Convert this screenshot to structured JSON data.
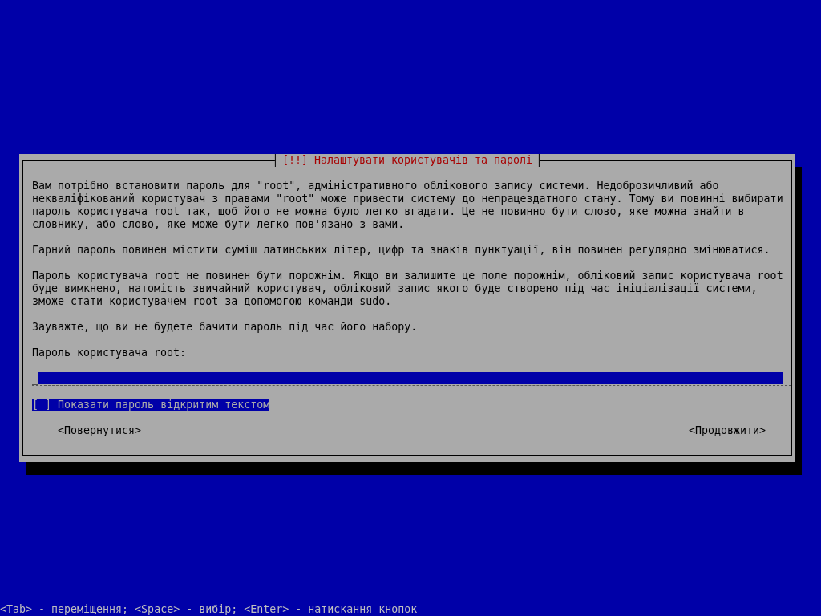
{
  "dialog": {
    "title": "[!!] Налаштувати користувачів та паролі",
    "paragraphs": [
      {
        "lines": [
          "Вам потрібно встановити пароль для \"root\", адміністративного облікового запису системи. Недоброзичливий або",
          "некваліфікований користувач з правами \"root\" може привести систему до непрацездатного стану. Тому ви повинні вибирати",
          "пароль користувача root так, щоб його не можна було легко вгадати. Це не повинно бути слово, яке можна знайти в",
          "словнику, або слово, яке може бути легко пов'язано з вами."
        ]
      },
      {
        "lines": [
          "Гарний пароль повинен містити суміш латинських літер, цифр та знаків пунктуації, він повинен регулярно змінюватися."
        ]
      },
      {
        "lines": [
          "Пароль користувача root не повинен бути порожнім. Якщо ви залишите це поле порожнім, обліковий запис користувача root",
          "буде вимкнено, натомість звичайний користувач, обліковий запис якого буде створено під час ініціалізації системи,",
          "зможе стати користувачем root за допомогою команди sudo."
        ]
      },
      {
        "lines": [
          "Зауважте, що ви не будете бачити пароль під час його набору."
        ]
      }
    ],
    "field_label": "Пароль користувача root:",
    "password_field": {
      "cursor": "_",
      "focused": false
    },
    "checkbox": {
      "box": "[ ]",
      "label": "Показати пароль відкритим текстом",
      "checked": false,
      "focused": true
    },
    "buttons": [
      {
        "label": "<Повернутися>",
        "focused": false
      },
      {
        "label": "<Продовжити>",
        "focused": false
      }
    ]
  },
  "status_bar": "<Tab> - переміщення; <Space> - вибір; <Enter> - натискання кнопок"
}
